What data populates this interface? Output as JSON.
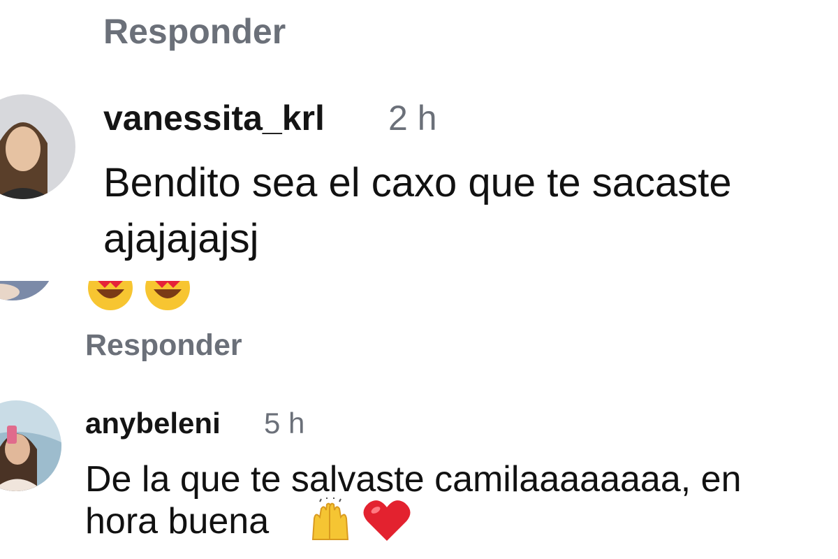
{
  "replies": {
    "top_label": "Responder",
    "mid_label": "Responder"
  },
  "comments": [
    {
      "username": "vanessita_krl",
      "time": "2 h",
      "text_line1": "Bendito sea el caxo que te sacaste",
      "text_line2": "ajajajajsj"
    },
    {
      "emojis": [
        "heart-eyes-emoji",
        "heart-eyes-emoji"
      ]
    },
    {
      "username": "anybeleni",
      "time": "5 h",
      "text_line1": "De la que te salvaste camilaaaaaaaa, en",
      "text_line2": "hora buena",
      "emojis": [
        "raising-hands-emoji",
        "red-heart-emoji"
      ]
    }
  ],
  "colors": {
    "muted": "#6b7079",
    "text": "#111111",
    "background": "#ffffff"
  }
}
